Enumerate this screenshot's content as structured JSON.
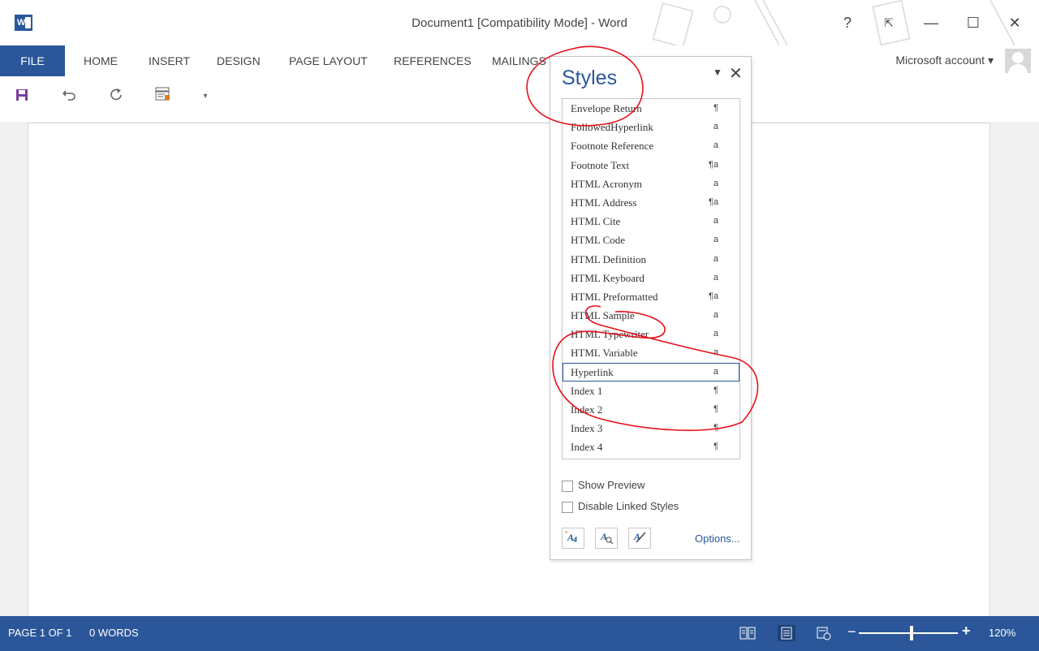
{
  "window": {
    "title": "Document1 [Compatibility Mode] - Word",
    "help": "?",
    "restore_ribbon": "⇱",
    "minimize": "—",
    "maximize": "☐",
    "close": "✕"
  },
  "ribbon": {
    "file": "FILE",
    "tabs": [
      "HOME",
      "INSERT",
      "DESIGN",
      "PAGE LAYOUT",
      "REFERENCES",
      "MAILINGS"
    ],
    "account": "Microsoft account ▾"
  },
  "qat": {
    "icons": [
      "save-icon",
      "undo-icon",
      "redo-icon",
      "print-layout-icon",
      "customize-dropdown-icon"
    ]
  },
  "styles_pane": {
    "title": "Styles",
    "items": [
      {
        "label": "Envelope Return",
        "sym": "¶"
      },
      {
        "label": "FollowedHyperlink",
        "sym": "a"
      },
      {
        "label": "Footnote Reference",
        "sym": "a"
      },
      {
        "label": "Footnote Text",
        "sym": "¶a"
      },
      {
        "label": "HTML Acronym",
        "sym": "a"
      },
      {
        "label": "HTML Address",
        "sym": "¶a"
      },
      {
        "label": "HTML Cite",
        "sym": "a"
      },
      {
        "label": "HTML Code",
        "sym": "a"
      },
      {
        "label": "HTML Definition",
        "sym": "a"
      },
      {
        "label": "HTML Keyboard",
        "sym": "a"
      },
      {
        "label": "HTML Preformatted",
        "sym": "¶a"
      },
      {
        "label": "HTML Sample",
        "sym": "a"
      },
      {
        "label": "HTML Typewriter",
        "sym": "a"
      },
      {
        "label": "HTML Variable",
        "sym": "a"
      },
      {
        "label": "Hyperlink",
        "sym": "a"
      },
      {
        "label": "Index 1",
        "sym": "¶"
      },
      {
        "label": "Index 2",
        "sym": "¶"
      },
      {
        "label": "Index 3",
        "sym": "¶"
      },
      {
        "label": "Index 4",
        "sym": "¶"
      }
    ],
    "selected": "Hyperlink",
    "show_preview": "Show Preview",
    "disable_linked": "Disable Linked Styles",
    "options": "Options...",
    "btn_new": "A",
    "btn_inspect": "A",
    "btn_manage": "A"
  },
  "status": {
    "page": "PAGE 1 OF 1",
    "words": "0 WORDS",
    "zoom": "120%",
    "zoom_minus": "−",
    "zoom_plus": "+"
  },
  "colors": {
    "accent": "#2b579a",
    "annotation": "#e8101a"
  }
}
